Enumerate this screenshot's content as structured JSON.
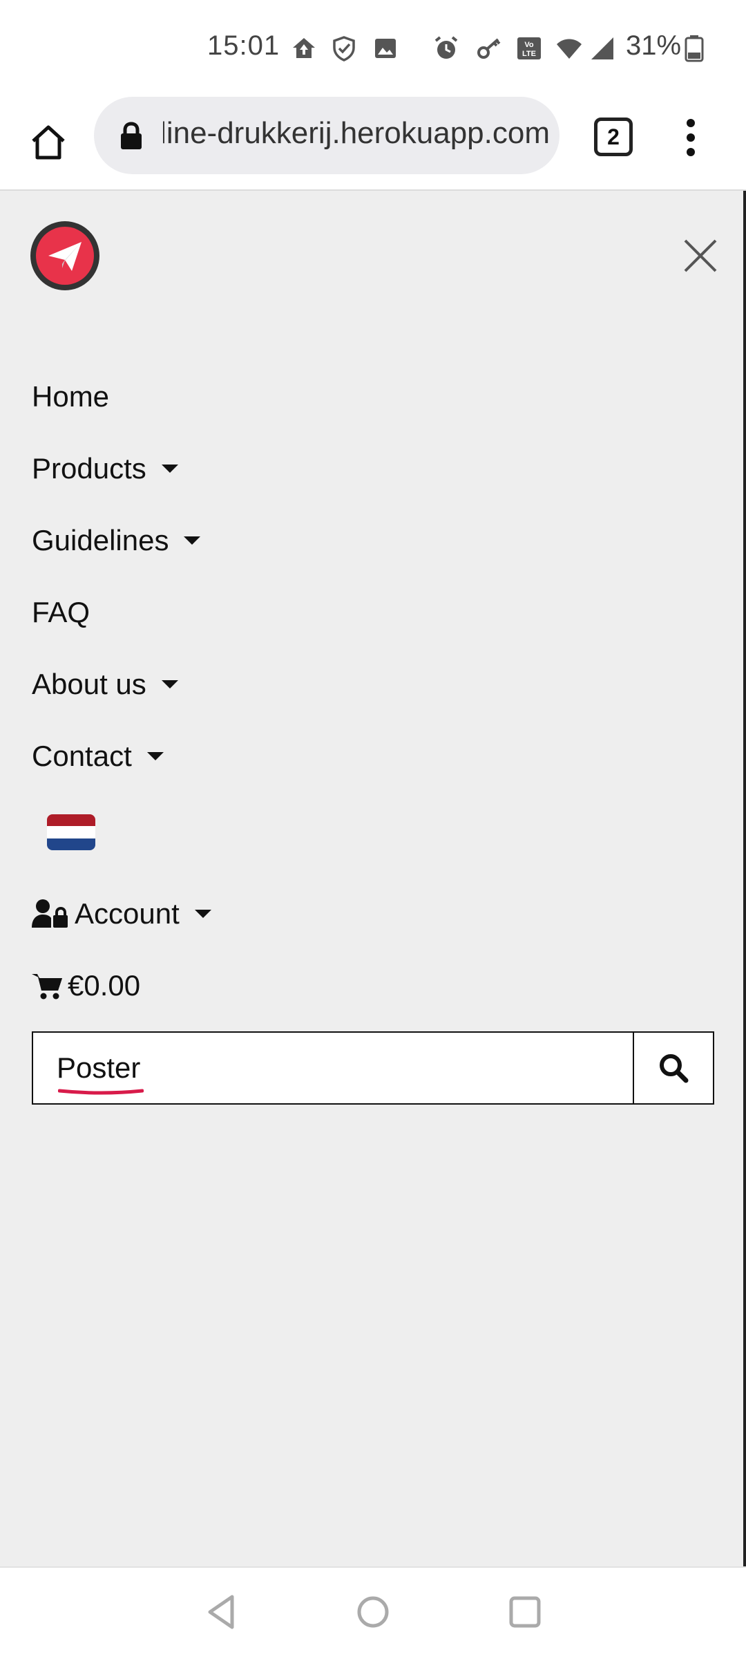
{
  "status_bar": {
    "time": "15:01",
    "battery": "31%",
    "icons": [
      "home-upload-icon",
      "shield-icon",
      "image-icon",
      "alarm-icon",
      "key-icon",
      "volte-icon",
      "wifi-icon",
      "signal-icon",
      "battery-icon"
    ]
  },
  "browser": {
    "url": "online-drukkerij.herokuapp.com",
    "tab_count": "2"
  },
  "menu": {
    "items": [
      {
        "label": "Home",
        "dropdown": false
      },
      {
        "label": "Products",
        "dropdown": true
      },
      {
        "label": "Guidelines",
        "dropdown": true
      },
      {
        "label": "FAQ",
        "dropdown": false
      },
      {
        "label": "About us",
        "dropdown": true
      },
      {
        "label": "Contact",
        "dropdown": true
      }
    ],
    "account_label": "Account",
    "cart_total": "€0.00"
  },
  "search": {
    "value": "Poster"
  },
  "colors": {
    "brand": "#e8334a",
    "page_bg": "#eeeeee"
  }
}
